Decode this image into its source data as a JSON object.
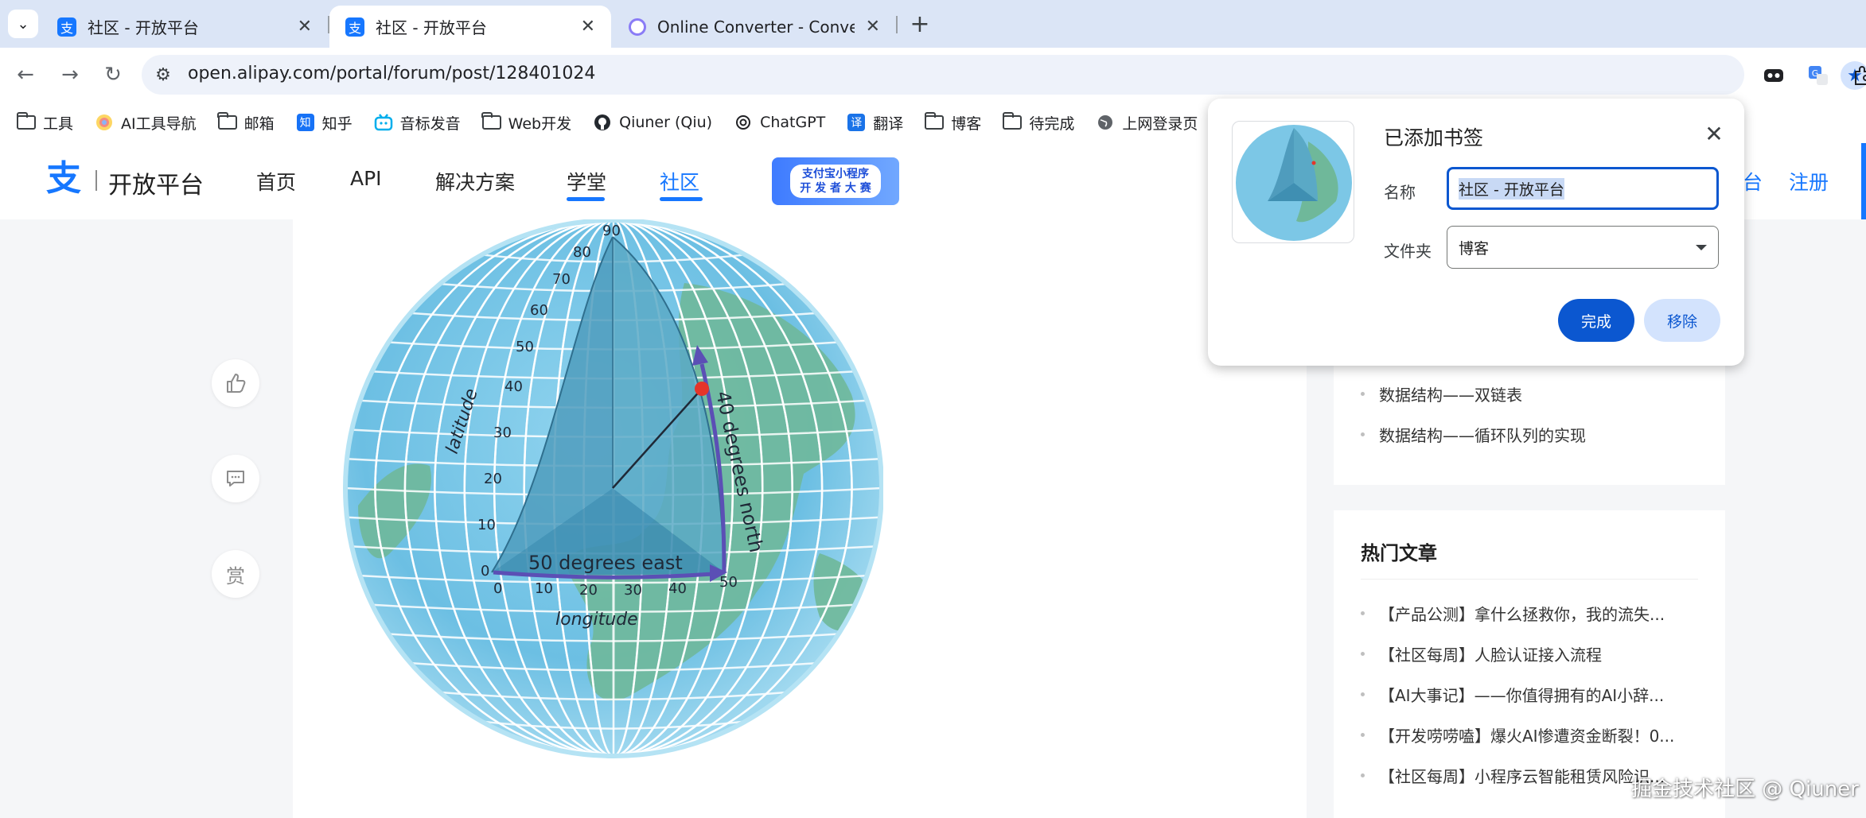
{
  "tabs": [
    {
      "title": "社区 - 开放平台",
      "active": false
    },
    {
      "title": "社区 - 开放平台",
      "active": true
    },
    {
      "title": "Online Converter - Convert Image, Video, Document, Audio",
      "active": false
    }
  ],
  "toolbar": {
    "url": "open.alipay.com/portal/forum/post/128401024"
  },
  "bookmarks": [
    {
      "label": "工具",
      "icon": "folder-icon"
    },
    {
      "label": "AI工具导航",
      "icon": "ai-nav-icon"
    },
    {
      "label": "邮箱",
      "icon": "folder-icon"
    },
    {
      "label": "知乎",
      "icon": "zhihu-icon"
    },
    {
      "label": "音标发音",
      "icon": "bilibili-icon"
    },
    {
      "label": "Web开发",
      "icon": "folder-icon"
    },
    {
      "label": "Qiuner (Qiu)",
      "icon": "github-icon"
    },
    {
      "label": "ChatGPT",
      "icon": "chatgpt-icon"
    },
    {
      "label": "翻译",
      "icon": "translate-icon"
    },
    {
      "label": "博客",
      "icon": "folder-icon"
    },
    {
      "label": "待完成",
      "icon": "folder-icon"
    },
    {
      "label": "上网登录页",
      "icon": "globe-icon"
    }
  ],
  "site": {
    "logo_text": "开放平台",
    "nav": [
      "首页",
      "API",
      "解决方案",
      "学堂",
      "社区"
    ],
    "promo_line1": "支付宝小程序",
    "promo_line2": "开 发 者 大 赛",
    "login_suffix": "台",
    "register": "注册"
  },
  "side_actions": [
    "like-icon",
    "comment-icon",
    "reward-icon"
  ],
  "reward_label": "赏",
  "globe_figure": {
    "lat_ticks": [
      "90",
      "80",
      "70",
      "60",
      "50",
      "40",
      "30",
      "20",
      "10",
      "0"
    ],
    "lon_ticks": [
      "0",
      "10",
      "20",
      "30",
      "40",
      "50"
    ],
    "lat_label": "latitude",
    "lon_label": "longitude",
    "east_label": "50 degrees east",
    "north_label": "40 degrees north"
  },
  "related": {
    "items": [
      "数据结构——双链表",
      "数据结构——循环队列的实现"
    ]
  },
  "hot_articles": {
    "title": "热门文章",
    "items": [
      "【产品公测】拿什么拯救你，我的流失...",
      "【社区每周】人脸认证接入流程",
      "【AI大事记】——你值得拥有的AI小辞...",
      "【开发唠唠嗑】爆火AI惨遭资金断裂！0...",
      "【社区每周】小程序云智能租赁风险识..."
    ]
  },
  "watermark": "掘金技术社区 @ Qiuner",
  "bookmark_popup": {
    "title": "已添加书签",
    "name_label": "名称",
    "name_value": "社区 - 开放平台",
    "folder_label": "文件夹",
    "folder_value": "博客",
    "done_label": "完成",
    "remove_label": "移除"
  },
  "colors": {
    "accent": "#1677ff",
    "chrome_accent": "#0b57d0",
    "tabstrip": "#dbe5f6"
  }
}
